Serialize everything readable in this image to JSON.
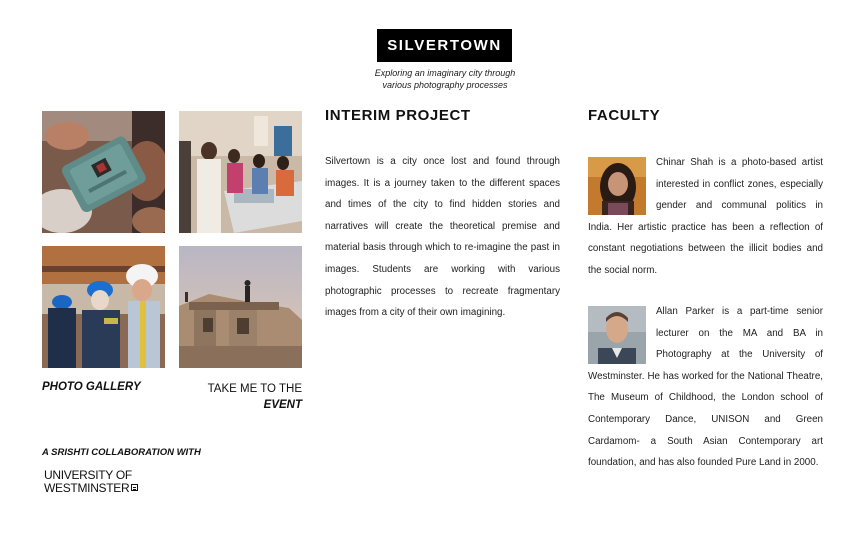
{
  "header": {
    "logo_text": "SILVERTOWN",
    "tagline_line1": "Exploring an imaginary city through",
    "tagline_line2": "various photography processes"
  },
  "gallery": {
    "photo_gallery_label": "PHOTO GALLERY",
    "event_link_line1": "TAKE ME TO THE",
    "event_link_line2": "EVENT"
  },
  "collaboration": {
    "label": "A SRISHTI COLLABORATION WITH",
    "university_line1": "UNIVERSITY OF",
    "university_line2": "WESTMINSTER"
  },
  "interim": {
    "heading": "INTERIM PROJECT",
    "body": "Silvertown is a city once lost and found through images. It is a journey taken to the different spaces and times of the city to find hidden stories and narratives will create the theoretical premise and material basis through which to re-imagine the past in images. Students are working with various photographic processes to recreate fragmentary images from a city of their own imagining."
  },
  "faculty": {
    "heading": "FACULTY",
    "members": [
      {
        "bio": "Chinar Shah is a photo-based artist interested in conflict zones, especially gender and communal politics in India. Her artistic practice has been a reflection of constant negotiations between the illicit bodies and the social norm."
      },
      {
        "bio": "Allan Parker is a part-time senior lecturer on the MA and BA in Photography at the University of Westminster. He has worked for the National Theatre, The Museum of Childhood, the London school of Contemporary Dance, UNISON and Green Cardamom- a South Asian Contemporary art foundation, and has also founded Pure Land in 2000."
      }
    ]
  },
  "colors": {
    "logo_background": "#000000",
    "logo_text": "#ffffff",
    "page_background": "#ffffff"
  }
}
